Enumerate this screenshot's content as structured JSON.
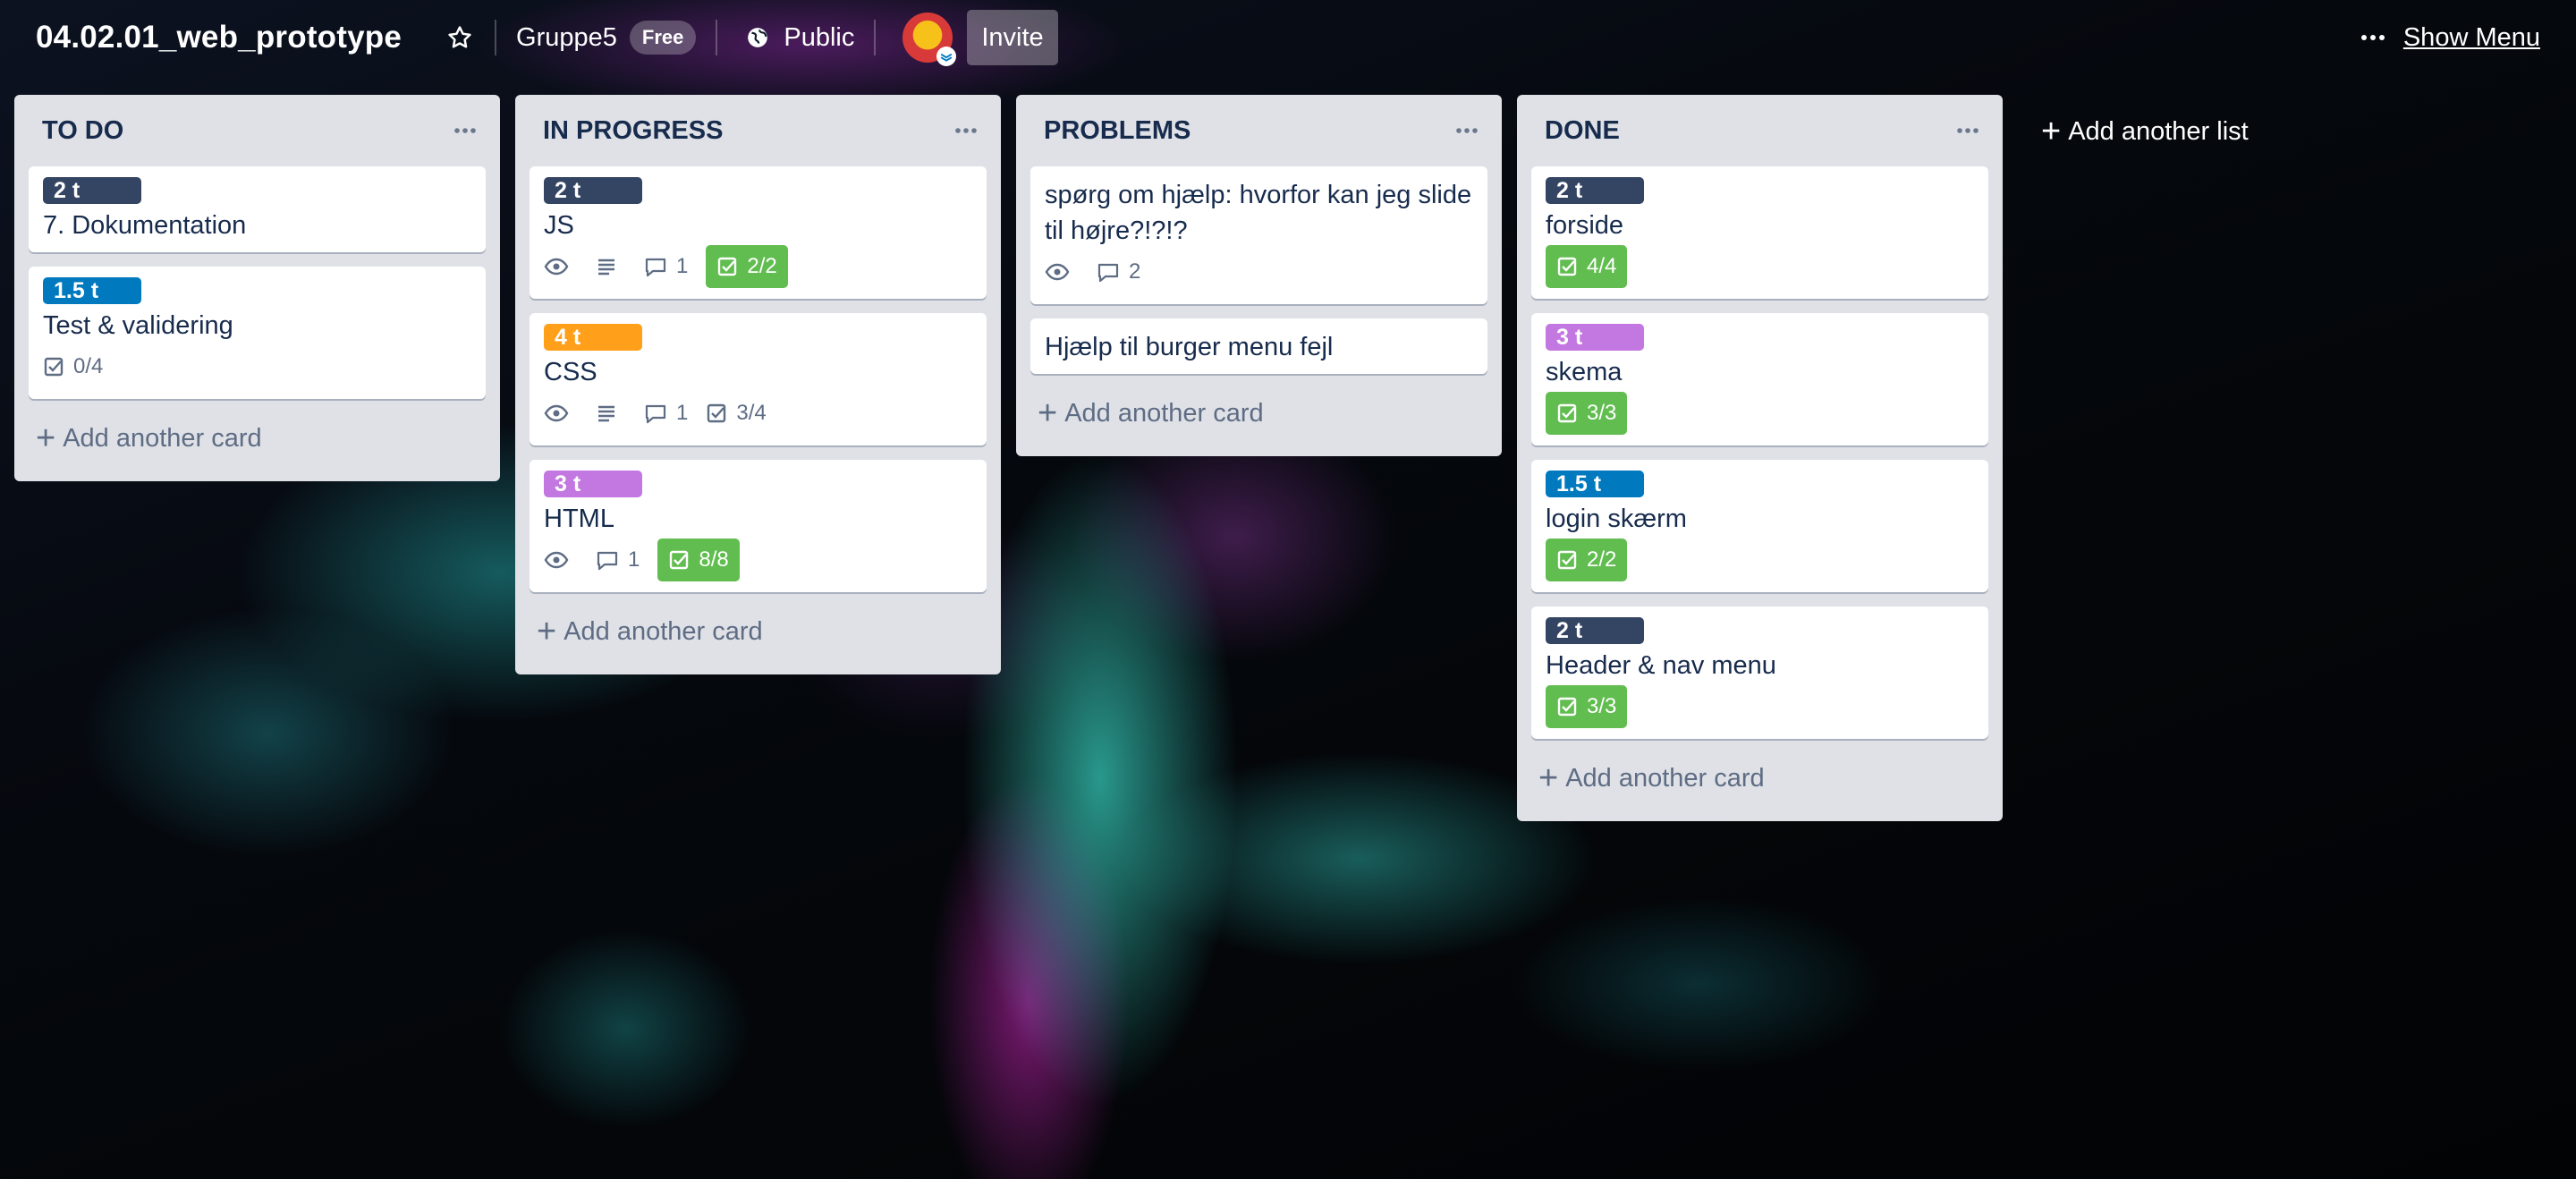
{
  "header": {
    "board_title": "04.02.01_web_prototype",
    "team_name": "Gruppe5",
    "team_plan": "Free",
    "visibility": "Public",
    "invite_label": "Invite",
    "show_menu_label": "Show Menu"
  },
  "lists": [
    {
      "title": "TO DO",
      "cards": [
        {
          "label": "2 t",
          "label_color": "#344563",
          "title": "7. Dokumentation"
        },
        {
          "label": "1.5 t",
          "label_color": "#0079bf",
          "title": "Test & validering",
          "checklist": "0/4"
        }
      ],
      "add_card_label": "Add another card"
    },
    {
      "title": "IN PROGRESS",
      "cards": [
        {
          "label": "2 t",
          "label_color": "#344563",
          "title": "JS",
          "comments": "1",
          "checklist": "2/2"
        },
        {
          "label": "4 t",
          "label_color": "#ff9f1a",
          "title": "CSS",
          "comments": "1",
          "checklist": "3/4"
        },
        {
          "label": "3 t",
          "label_color": "#c377e0",
          "title": "HTML",
          "comments": "1",
          "checklist": "8/8"
        }
      ],
      "add_card_label": "Add another card"
    },
    {
      "title": "PROBLEMS",
      "cards": [
        {
          "title": "spørg om hjælp: hvorfor kan jeg slide til højre?!?!?",
          "comments": "2"
        },
        {
          "title": "Hjælp til burger menu fejl"
        }
      ],
      "add_card_label": "Add another card"
    },
    {
      "title": "DONE",
      "cards": [
        {
          "label": "2 t",
          "label_color": "#344563",
          "title": "forside",
          "checklist": "4/4"
        },
        {
          "label": "3 t",
          "label_color": "#c377e0",
          "title": "skema",
          "checklist": "3/3"
        },
        {
          "label": "1.5 t",
          "label_color": "#0079bf",
          "title": "login skærm",
          "checklist": "2/2"
        },
        {
          "label": "2 t",
          "label_color": "#344563",
          "title": "Header & nav menu",
          "checklist": "3/3"
        }
      ],
      "add_card_label": "Add another card"
    }
  ],
  "add_list_label": "Add another list",
  "colors": {
    "list_bg": "#dfe1e6",
    "card_text": "#172b4d",
    "checklist_complete": "#61bd4f",
    "label_dark": "#344563",
    "label_blue": "#0079bf",
    "label_orange": "#ff9f1a",
    "label_purple": "#c377e0"
  },
  "icons": [
    "star-icon",
    "globe-icon",
    "more-icon",
    "eye-icon",
    "description-icon",
    "comment-icon",
    "checklist-icon",
    "plus-icon"
  ]
}
